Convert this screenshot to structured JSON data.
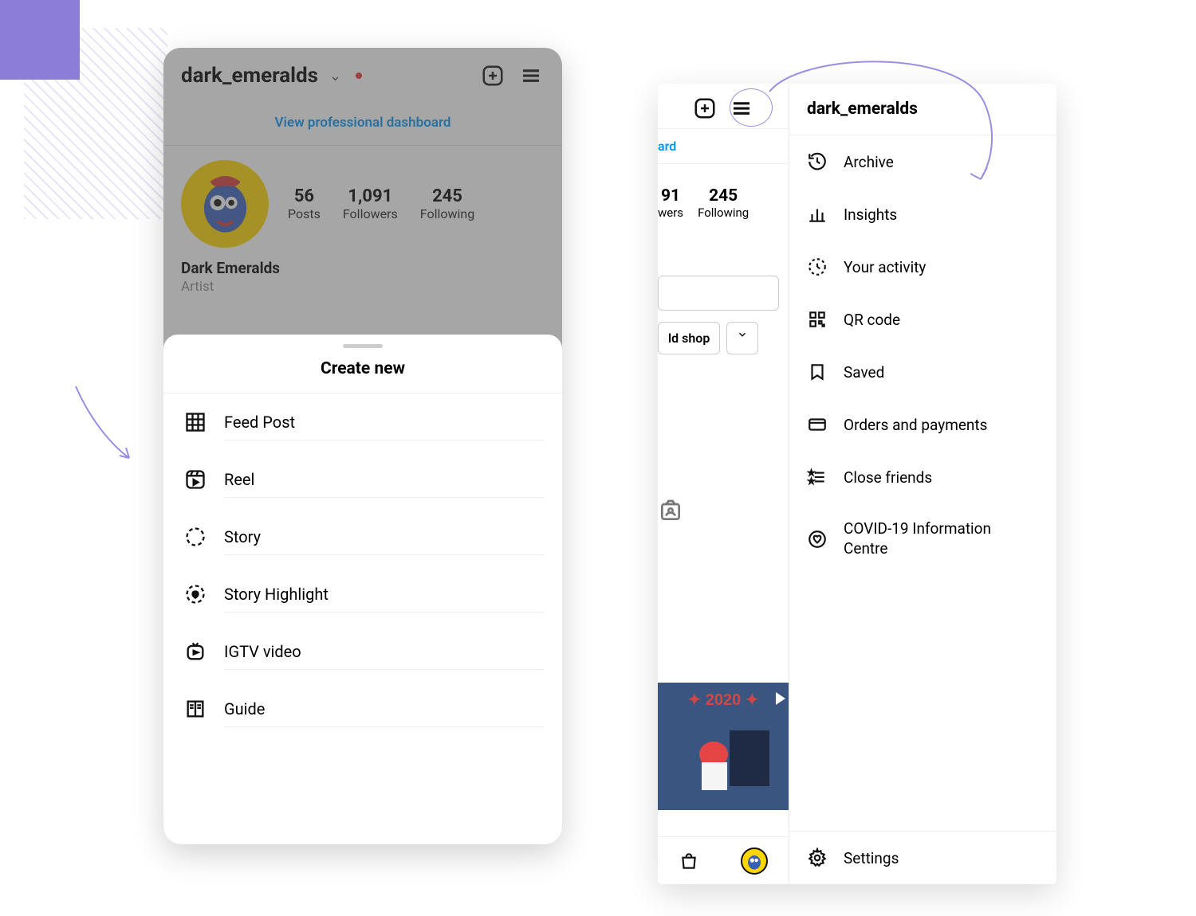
{
  "left_phone": {
    "username": "dark_emeralds",
    "dashboard_link": "View professional dashboard",
    "stats": {
      "posts": {
        "count": "56",
        "label": "Posts"
      },
      "followers": {
        "count": "1,091",
        "label": "Followers"
      },
      "following": {
        "count": "245",
        "label": "Following"
      }
    },
    "display_name": "Dark Emeralds",
    "bio_role": "Artist",
    "sheet": {
      "title": "Create new",
      "items": [
        {
          "label": "Feed Post",
          "icon": "grid-icon"
        },
        {
          "label": "Reel",
          "icon": "reel-icon"
        },
        {
          "label": "Story",
          "icon": "story-icon"
        },
        {
          "label": "Story Highlight",
          "icon": "story-highlight-icon"
        },
        {
          "label": "IGTV video",
          "icon": "igtv-icon"
        },
        {
          "label": "Guide",
          "icon": "guide-icon"
        }
      ]
    }
  },
  "right_phone": {
    "username": "dark_emeralds",
    "bg": {
      "dashboard_partial": "ard",
      "followers_partial_num": "91",
      "followers_partial_lbl": "wers",
      "following_num": "245",
      "following_lbl": "Following",
      "shop_btn_partial": "ld shop",
      "thumb_year": "2020"
    },
    "menu": {
      "items": [
        {
          "label": "Archive",
          "icon": "archive-icon"
        },
        {
          "label": "Insights",
          "icon": "insights-icon"
        },
        {
          "label": "Your activity",
          "icon": "activity-icon"
        },
        {
          "label": "QR code",
          "icon": "qr-icon"
        },
        {
          "label": "Saved",
          "icon": "saved-icon"
        },
        {
          "label": "Orders and payments",
          "icon": "card-icon"
        },
        {
          "label": "Close friends",
          "icon": "close-friends-icon"
        },
        {
          "label": "COVID-19 Information Centre",
          "icon": "heart-info-icon"
        }
      ],
      "settings_label": "Settings"
    }
  }
}
